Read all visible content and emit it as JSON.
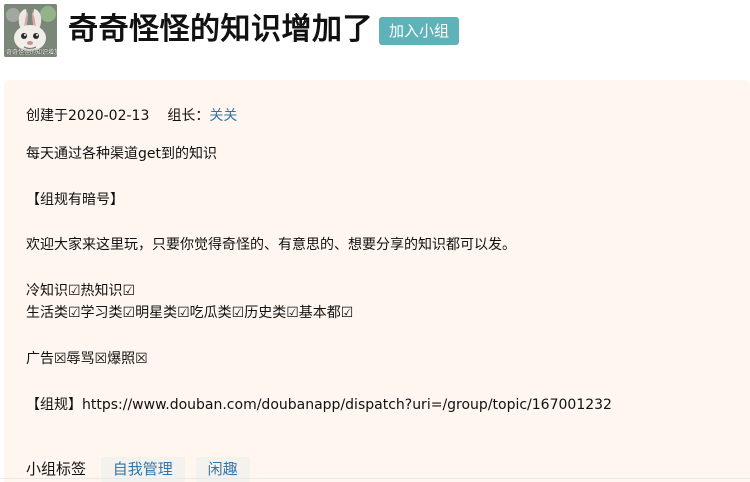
{
  "header": {
    "avatar_caption": "奇奇怪怪的知识增加了",
    "title": "奇奇怪怪的知识增加了",
    "join_button": "加入小组"
  },
  "group_info": {
    "created_prefix": "创建于",
    "created_date": "2020-02-13",
    "owner_label": "组长：",
    "owner_name": "关关",
    "line1": "每天通过各种渠道get到的知识",
    "line2": "【组规有暗号】",
    "line3": "欢迎大家来这里玩，只要你觉得奇怪的、有意思的、想要分享的知识都可以发。",
    "line4": "冷知识☑热知识☑",
    "line5": "生活类☑学习类☑明星类☑吃瓜类☑历史类☑基本都☑",
    "line6": "广告☒辱骂☒爆照☒",
    "line7": "【组规】https://www.douban.com/doubanapp/dispatch?uri=/group/topic/167001232"
  },
  "tags": {
    "label": "小组标签",
    "items": [
      "自我管理",
      "闲趣"
    ]
  },
  "colors": {
    "accent": "#5fb3b8",
    "link": "#3377aa",
    "card_background": "#fff6ef"
  }
}
